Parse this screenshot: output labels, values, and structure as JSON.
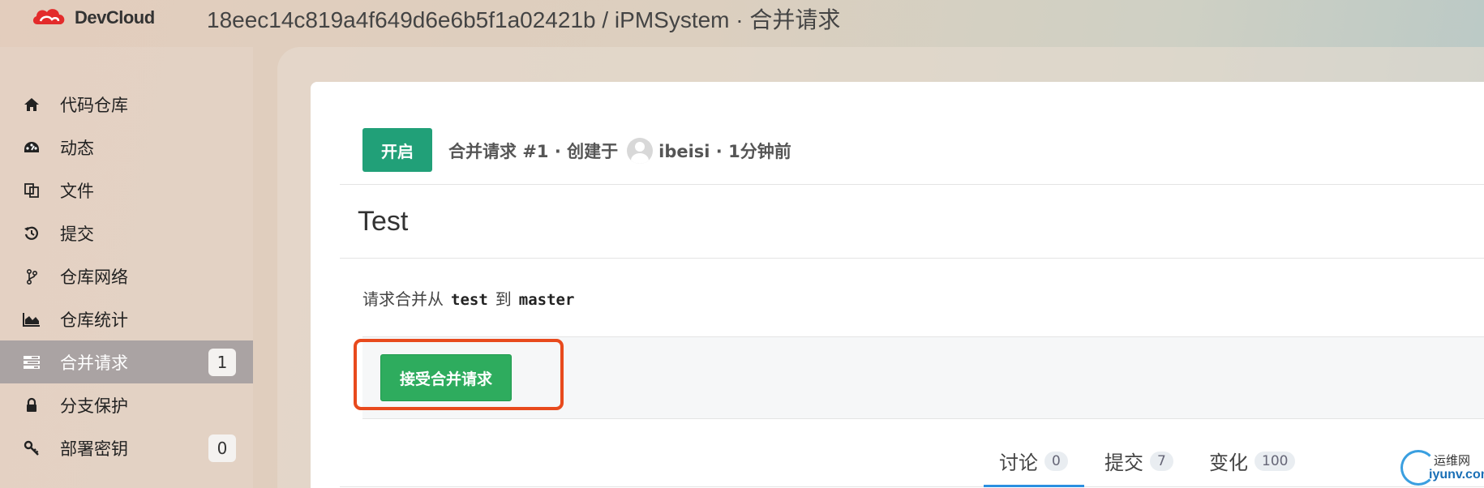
{
  "header": {
    "logo_text": "DevCloud",
    "title": "18eec14c819a4f649d6e6b5f1a02421b / iPMSystem · 合并请求"
  },
  "sidebar": {
    "items": [
      {
        "label": "代码仓库",
        "icon": "home-icon"
      },
      {
        "label": "动态",
        "icon": "dashboard-icon"
      },
      {
        "label": "文件",
        "icon": "files-icon"
      },
      {
        "label": "提交",
        "icon": "history-icon"
      },
      {
        "label": "仓库网络",
        "icon": "branch-icon"
      },
      {
        "label": "仓库统计",
        "icon": "area-chart-icon"
      },
      {
        "label": "合并请求",
        "icon": "tasks-icon",
        "badge": "1",
        "active": true
      },
      {
        "label": "分支保护",
        "icon": "lock-icon"
      },
      {
        "label": "部署密钥",
        "icon": "key-icon",
        "badge": "0"
      }
    ]
  },
  "pr": {
    "status": "开启",
    "meta_prefix": "合并请求 #1 · 创建于",
    "meta_user": "ibeisi · 1分钟前",
    "title": "Test",
    "desc_prefix": "请求合并从",
    "source_branch": "test",
    "desc_mid": "到",
    "target_branch": "master",
    "accept_label": "接受合并请求"
  },
  "tabs": [
    {
      "label": "讨论",
      "count": "0",
      "active": true
    },
    {
      "label": "提交",
      "count": "7"
    },
    {
      "label": "变化",
      "count": "100"
    }
  ],
  "watermark": {
    "cn": "运维网",
    "en": "iyunv.com"
  },
  "colors": {
    "status_green": "#21a078",
    "accept_green": "#2eac5e",
    "highlight_red": "#e84a1d",
    "active_tab_blue": "#2b8fe0",
    "sidebar_active": "#aaa3a3"
  }
}
